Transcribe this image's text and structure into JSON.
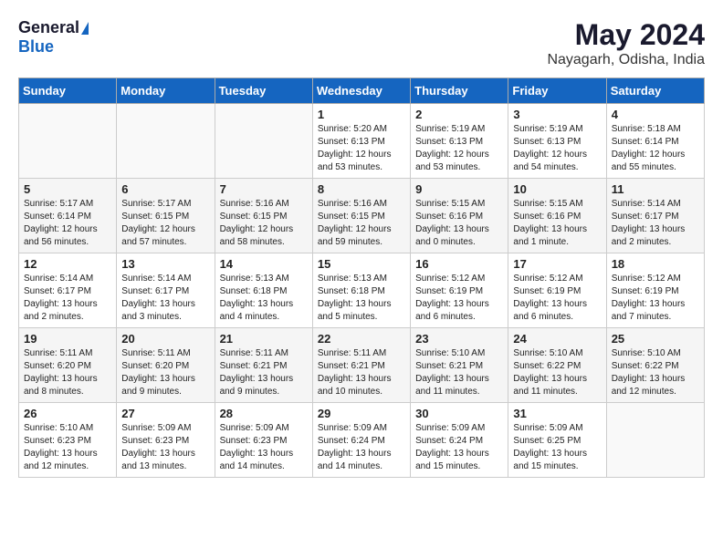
{
  "logo": {
    "general": "General",
    "blue": "Blue"
  },
  "title": "May 2024",
  "subtitle": "Nayagarh, Odisha, India",
  "days_of_week": [
    "Sunday",
    "Monday",
    "Tuesday",
    "Wednesday",
    "Thursday",
    "Friday",
    "Saturday"
  ],
  "weeks": [
    [
      {
        "day": "",
        "info": ""
      },
      {
        "day": "",
        "info": ""
      },
      {
        "day": "",
        "info": ""
      },
      {
        "day": "1",
        "info": "Sunrise: 5:20 AM\nSunset: 6:13 PM\nDaylight: 12 hours\nand 53 minutes."
      },
      {
        "day": "2",
        "info": "Sunrise: 5:19 AM\nSunset: 6:13 PM\nDaylight: 12 hours\nand 53 minutes."
      },
      {
        "day": "3",
        "info": "Sunrise: 5:19 AM\nSunset: 6:13 PM\nDaylight: 12 hours\nand 54 minutes."
      },
      {
        "day": "4",
        "info": "Sunrise: 5:18 AM\nSunset: 6:14 PM\nDaylight: 12 hours\nand 55 minutes."
      }
    ],
    [
      {
        "day": "5",
        "info": "Sunrise: 5:17 AM\nSunset: 6:14 PM\nDaylight: 12 hours\nand 56 minutes."
      },
      {
        "day": "6",
        "info": "Sunrise: 5:17 AM\nSunset: 6:15 PM\nDaylight: 12 hours\nand 57 minutes."
      },
      {
        "day": "7",
        "info": "Sunrise: 5:16 AM\nSunset: 6:15 PM\nDaylight: 12 hours\nand 58 minutes."
      },
      {
        "day": "8",
        "info": "Sunrise: 5:16 AM\nSunset: 6:15 PM\nDaylight: 12 hours\nand 59 minutes."
      },
      {
        "day": "9",
        "info": "Sunrise: 5:15 AM\nSunset: 6:16 PM\nDaylight: 13 hours\nand 0 minutes."
      },
      {
        "day": "10",
        "info": "Sunrise: 5:15 AM\nSunset: 6:16 PM\nDaylight: 13 hours\nand 1 minute."
      },
      {
        "day": "11",
        "info": "Sunrise: 5:14 AM\nSunset: 6:17 PM\nDaylight: 13 hours\nand 2 minutes."
      }
    ],
    [
      {
        "day": "12",
        "info": "Sunrise: 5:14 AM\nSunset: 6:17 PM\nDaylight: 13 hours\nand 2 minutes."
      },
      {
        "day": "13",
        "info": "Sunrise: 5:14 AM\nSunset: 6:17 PM\nDaylight: 13 hours\nand 3 minutes."
      },
      {
        "day": "14",
        "info": "Sunrise: 5:13 AM\nSunset: 6:18 PM\nDaylight: 13 hours\nand 4 minutes."
      },
      {
        "day": "15",
        "info": "Sunrise: 5:13 AM\nSunset: 6:18 PM\nDaylight: 13 hours\nand 5 minutes."
      },
      {
        "day": "16",
        "info": "Sunrise: 5:12 AM\nSunset: 6:19 PM\nDaylight: 13 hours\nand 6 minutes."
      },
      {
        "day": "17",
        "info": "Sunrise: 5:12 AM\nSunset: 6:19 PM\nDaylight: 13 hours\nand 6 minutes."
      },
      {
        "day": "18",
        "info": "Sunrise: 5:12 AM\nSunset: 6:19 PM\nDaylight: 13 hours\nand 7 minutes."
      }
    ],
    [
      {
        "day": "19",
        "info": "Sunrise: 5:11 AM\nSunset: 6:20 PM\nDaylight: 13 hours\nand 8 minutes."
      },
      {
        "day": "20",
        "info": "Sunrise: 5:11 AM\nSunset: 6:20 PM\nDaylight: 13 hours\nand 9 minutes."
      },
      {
        "day": "21",
        "info": "Sunrise: 5:11 AM\nSunset: 6:21 PM\nDaylight: 13 hours\nand 9 minutes."
      },
      {
        "day": "22",
        "info": "Sunrise: 5:11 AM\nSunset: 6:21 PM\nDaylight: 13 hours\nand 10 minutes."
      },
      {
        "day": "23",
        "info": "Sunrise: 5:10 AM\nSunset: 6:21 PM\nDaylight: 13 hours\nand 11 minutes."
      },
      {
        "day": "24",
        "info": "Sunrise: 5:10 AM\nSunset: 6:22 PM\nDaylight: 13 hours\nand 11 minutes."
      },
      {
        "day": "25",
        "info": "Sunrise: 5:10 AM\nSunset: 6:22 PM\nDaylight: 13 hours\nand 12 minutes."
      }
    ],
    [
      {
        "day": "26",
        "info": "Sunrise: 5:10 AM\nSunset: 6:23 PM\nDaylight: 13 hours\nand 12 minutes."
      },
      {
        "day": "27",
        "info": "Sunrise: 5:09 AM\nSunset: 6:23 PM\nDaylight: 13 hours\nand 13 minutes."
      },
      {
        "day": "28",
        "info": "Sunrise: 5:09 AM\nSunset: 6:23 PM\nDaylight: 13 hours\nand 14 minutes."
      },
      {
        "day": "29",
        "info": "Sunrise: 5:09 AM\nSunset: 6:24 PM\nDaylight: 13 hours\nand 14 minutes."
      },
      {
        "day": "30",
        "info": "Sunrise: 5:09 AM\nSunset: 6:24 PM\nDaylight: 13 hours\nand 15 minutes."
      },
      {
        "day": "31",
        "info": "Sunrise: 5:09 AM\nSunset: 6:25 PM\nDaylight: 13 hours\nand 15 minutes."
      },
      {
        "day": "",
        "info": ""
      }
    ]
  ]
}
